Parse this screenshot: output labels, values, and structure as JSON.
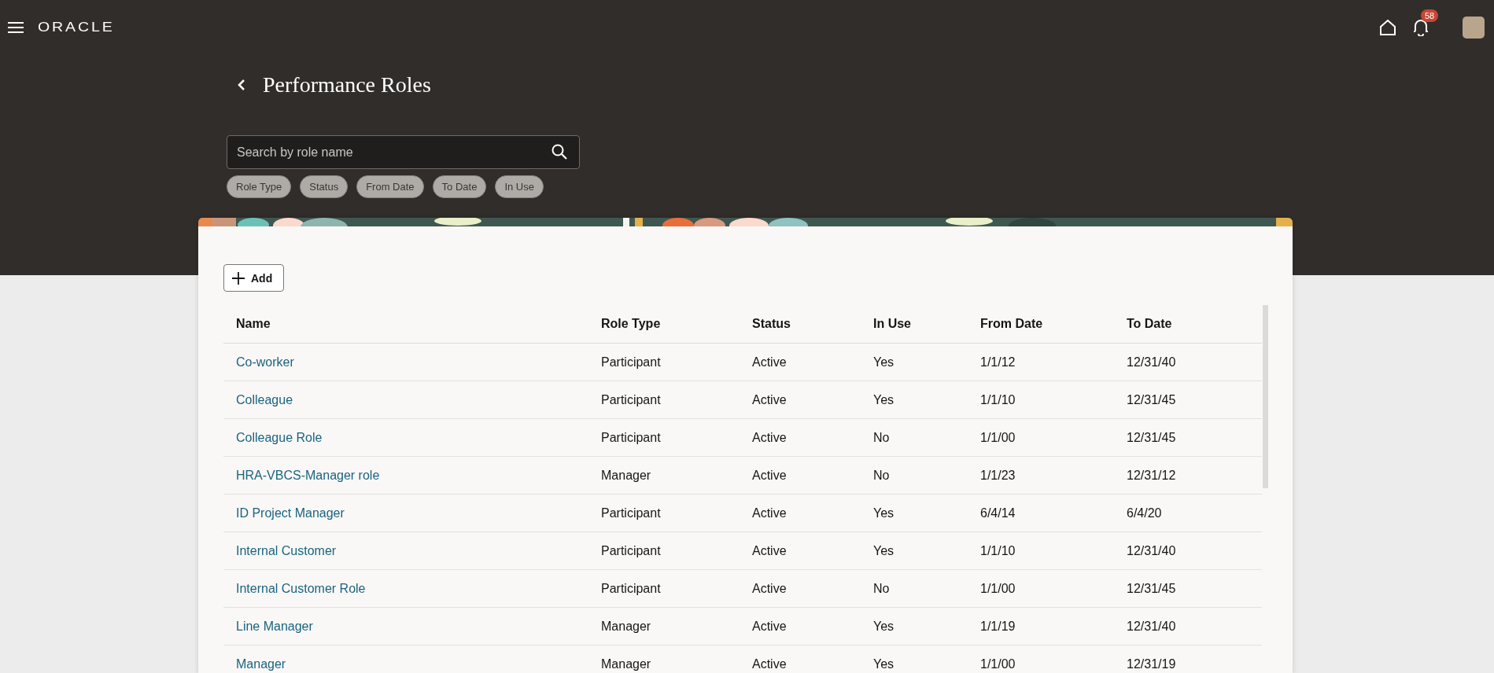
{
  "top_bar": {
    "logo": "ORACLE",
    "notifications_badge": "58"
  },
  "page": {
    "title": "Performance Roles"
  },
  "search": {
    "placeholder": "Search by role name"
  },
  "filters": [
    "Role Type",
    "Status",
    "From Date",
    "To Date",
    "In Use"
  ],
  "toolbar": {
    "add_button": "Add"
  },
  "table": {
    "columns": [
      {
        "label": "Name",
        "kind": "link"
      },
      {
        "label": "Role Type",
        "kind": "text"
      },
      {
        "label": "Status",
        "kind": "text"
      },
      {
        "label": "In Use",
        "kind": "text"
      },
      {
        "label": "From Date",
        "kind": "text"
      },
      {
        "label": "To Date",
        "kind": "text"
      }
    ],
    "rows": [
      [
        "Co-worker",
        "Participant",
        "Active",
        "Yes",
        "1/1/12",
        "12/31/40"
      ],
      [
        "Colleague",
        "Participant",
        "Active",
        "Yes",
        "1/1/10",
        "12/31/45"
      ],
      [
        "Colleague Role",
        "Participant",
        "Active",
        "No",
        "1/1/00",
        "12/31/45"
      ],
      [
        "HRA-VBCS-Manager role",
        "Manager",
        "Active",
        "No",
        "1/1/23",
        "12/31/12"
      ],
      [
        "ID Project Manager",
        "Participant",
        "Active",
        "Yes",
        "6/4/14",
        "6/4/20"
      ],
      [
        "Internal Customer",
        "Participant",
        "Active",
        "Yes",
        "1/1/10",
        "12/31/40"
      ],
      [
        "Internal Customer Role",
        "Participant",
        "Active",
        "No",
        "1/1/00",
        "12/31/45"
      ],
      [
        "Line Manager",
        "Manager",
        "Active",
        "Yes",
        "1/1/19",
        "12/31/40"
      ],
      [
        "Manager",
        "Manager",
        "Active",
        "Yes",
        "1/1/00",
        "12/31/19"
      ]
    ]
  }
}
